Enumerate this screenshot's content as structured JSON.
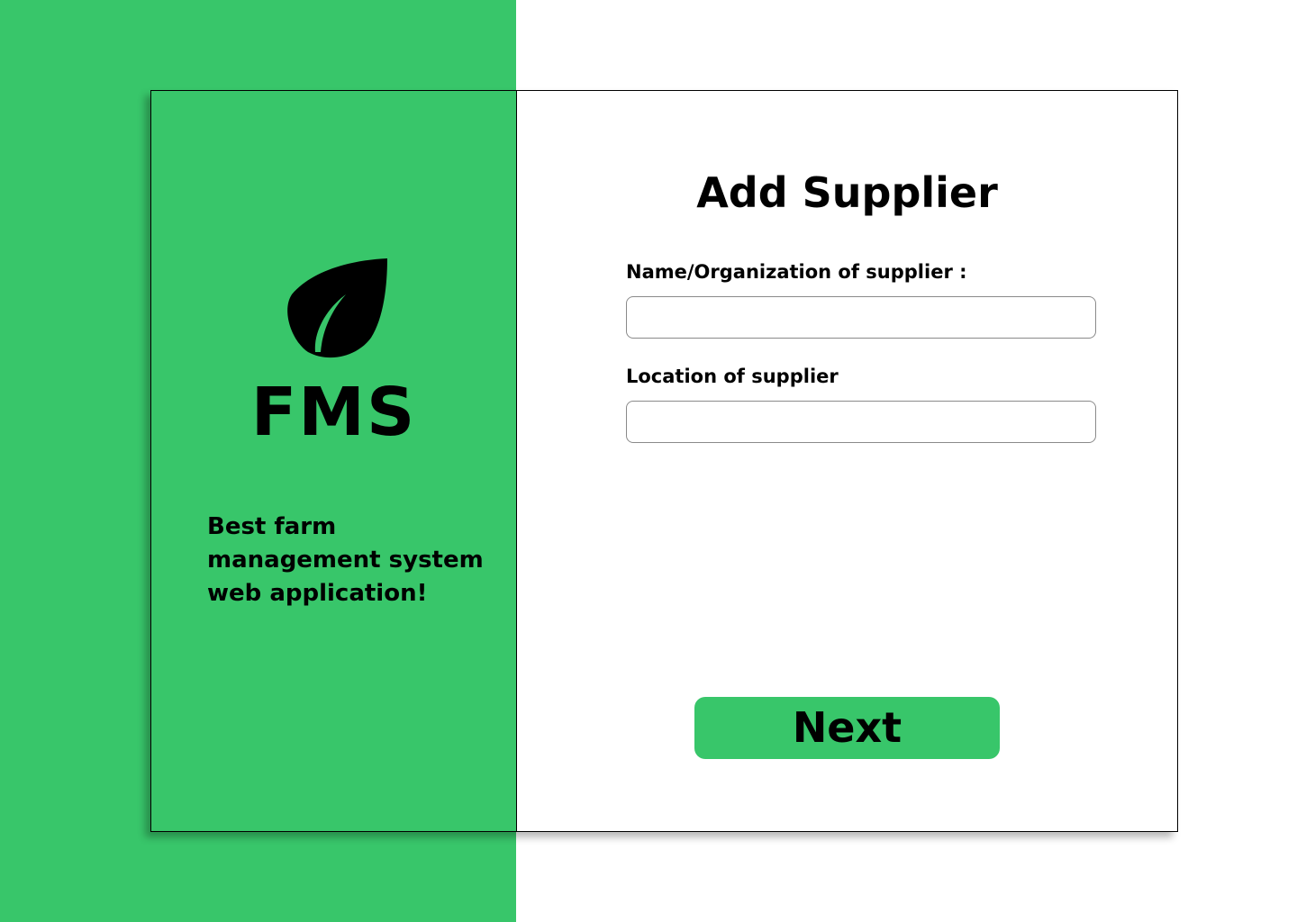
{
  "colors": {
    "brand_green": "#38c66a",
    "text": "#000000",
    "background": "#ffffff"
  },
  "brand": {
    "logo_icon": "leaf-icon",
    "name": "FMS",
    "tagline": "Best farm management system web application!"
  },
  "form": {
    "title": "Add Supplier",
    "fields": [
      {
        "label": "Name/Organization of supplier :",
        "value": ""
      },
      {
        "label": "Location of supplier",
        "value": ""
      }
    ],
    "next_label": "Next"
  }
}
